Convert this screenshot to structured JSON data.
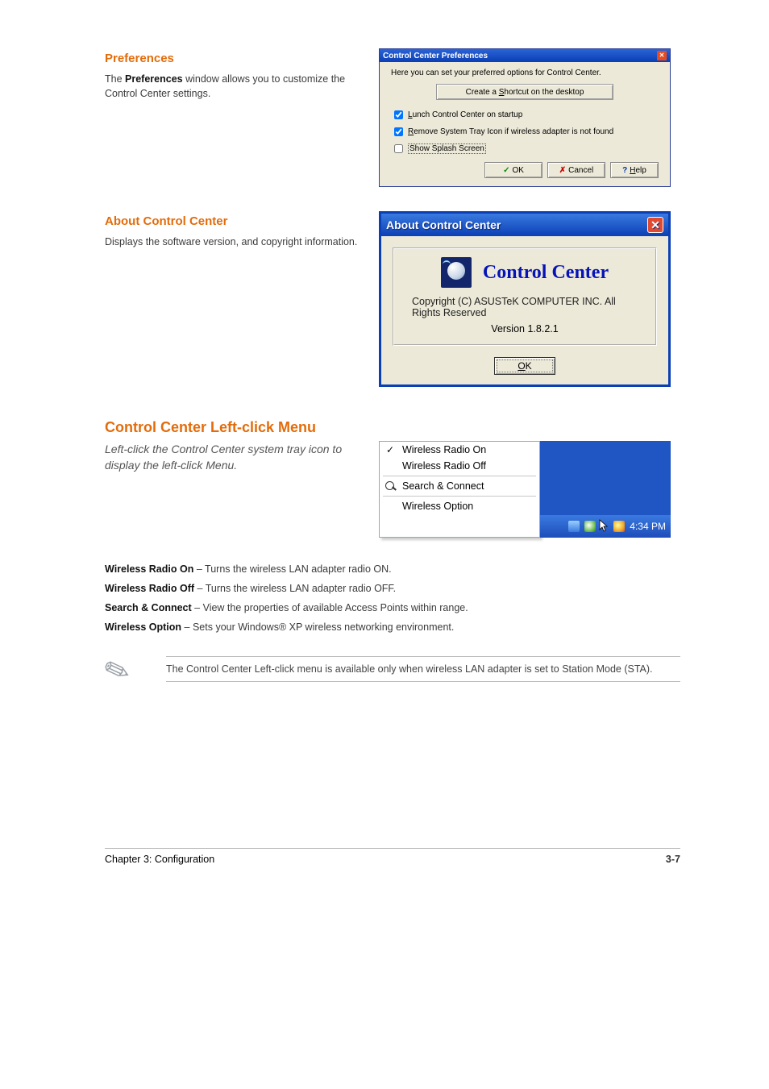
{
  "preferences_section": {
    "title": "Preferences",
    "body_html": "The <b>Preferences</b> window allows you to customize the Control Center settings."
  },
  "prefs_dialog": {
    "title": "Control Center Preferences",
    "intro": "Here you can set your preferred options for Control Center.",
    "shortcut_button": "Create a Shortcut on the desktop",
    "checkboxes": {
      "lunch": {
        "checked": true,
        "prefix": "L",
        "rest": "unch Control Center on startup"
      },
      "remove": {
        "checked": true,
        "prefix": "R",
        "rest": "emove System Tray Icon if wireless adapter is not found"
      },
      "splash": {
        "checked": false,
        "text": "Show Splash Screen"
      }
    },
    "buttons": {
      "ok": "OK",
      "cancel": "Cancel",
      "help_prefix": "H",
      "help_rest": "elp"
    }
  },
  "about_section": {
    "title": "About Control Center",
    "body": "Displays the software version, and copyright information."
  },
  "about_dialog": {
    "title": "About Control Center",
    "product_name": "Control Center",
    "copyright": "Copyright (C) ASUSTeK COMPUTER INC. All Rights Reserved",
    "version": "Version 1.8.2.1",
    "ok_prefix": "O",
    "ok_rest": "K"
  },
  "leftclick_section": {
    "heading": "Control Center Left-click Menu",
    "body_lead": "Left-click the Control Center system tray icon to display the left-click Menu.",
    "items": {
      "radio_on": "Wireless Radio On",
      "radio_off": "Wireless Radio Off",
      "search": "Search & Connect",
      "option": "Wireless Option"
    },
    "taskbar_time": "4:34 PM",
    "paragraphs": [
      {
        "label": "Wireless Radio On",
        "text": "– Turns the wireless LAN adapter radio ON."
      },
      {
        "label": "Wireless Radio Off",
        "text": "– Turns the wireless LAN adapter radio OFF."
      },
      {
        "label": "Search & Connect",
        "text": "– View the properties of available Access Points within range."
      },
      {
        "label": "Wireless Option",
        "text": "– Sets your Windows® XP wireless networking environment."
      }
    ]
  },
  "note": "The Control Center Left-click menu is available only when wireless LAN adapter is set to Station Mode (STA).",
  "footer": {
    "chapter": "Chapter 3: Configuration",
    "page": "3-7"
  }
}
